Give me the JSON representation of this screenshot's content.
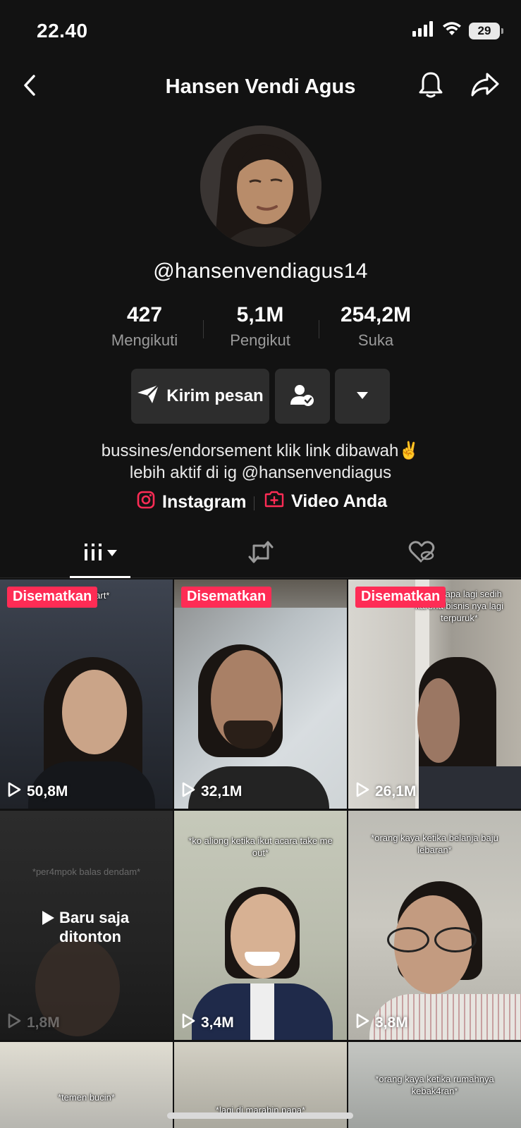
{
  "status_bar": {
    "time": "22.40",
    "battery": "29"
  },
  "header": {
    "title": "Hansen Vendi Agus"
  },
  "profile": {
    "username": "@hansenvendiagus14",
    "stats": [
      {
        "value": "427",
        "label": "Mengikuti"
      },
      {
        "value": "5,1M",
        "label": "Pengikut"
      },
      {
        "value": "254,2M",
        "label": "Suka"
      }
    ],
    "message_button": "Kirim pesan",
    "bio_line1": "bussines/endorsement klik link dibawah✌️",
    "bio_line2": "lebih aktif di ig @hansenvendiagus",
    "links": {
      "instagram": "Instagram",
      "your_videos": "Video Anda"
    }
  },
  "colors": {
    "accent": "#fe2c55",
    "background": "#121212",
    "button_bg": "#2d2d2d"
  },
  "videos": [
    {
      "pinned": "Disematkan",
      "views": "50,8M",
      "caption": "di alfamart*"
    },
    {
      "pinned": "Disematkan",
      "views": "32,1M",
      "caption": ""
    },
    {
      "pinned": "Disematkan",
      "views": "26,1M",
      "caption": "*saat papa lagi sedih karena bisnis nya lagi terpuruk*"
    },
    {
      "views": "1,8M",
      "caption": "*per4mpok balas dendam*",
      "just_watched": "Baru saja ditonton"
    },
    {
      "views": "3,4M",
      "caption": "*ko aliong ketika ikut acara take me out*"
    },
    {
      "views": "3,8M",
      "caption": "*orang kaya ketika belanja baju lebaran*"
    },
    {
      "caption": "*temen bucin*"
    },
    {
      "caption": "*lagi di marahin papa*"
    },
    {
      "caption": "*orang kaya ketika rumahnya kebak4ran*"
    }
  ]
}
